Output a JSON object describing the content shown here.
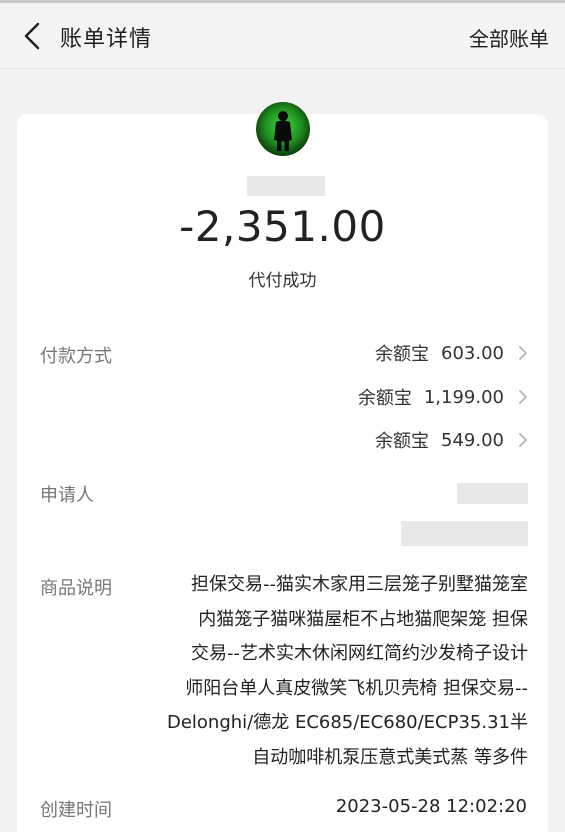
{
  "header": {
    "title": "账单详情",
    "right_link": "全部账单"
  },
  "bill": {
    "amount": "-2,351.00",
    "status": "代付成功"
  },
  "details": {
    "payment_label": "付款方式",
    "payments": [
      {
        "method": "余额宝",
        "amount": "603.00"
      },
      {
        "method": "余额宝",
        "amount": "1,199.00"
      },
      {
        "method": "余额宝",
        "amount": "549.00"
      }
    ],
    "applicant_label": "申请人",
    "goods_label": "商品说明",
    "goods_lines": [
      "担保交易--猫实木家用三层笼子别墅猫笼室",
      "内猫笼子猫咪猫屋柜不占地猫爬架笼 担保",
      "交易--艺术实木休闲网红简约沙发椅子设计",
      "师阳台单人真皮微笑飞机贝壳椅 担保交易--",
      "Delonghi/德龙 EC685/EC680/ECP35.31半",
      "自动咖啡机泵压意式美式蒸 等多件"
    ],
    "created_label": "创建时间",
    "created_value": "2023-05-28 12:02:20"
  }
}
